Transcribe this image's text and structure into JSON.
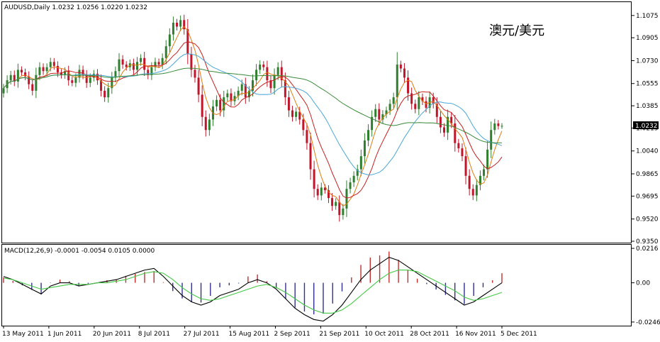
{
  "chart_data": {
    "type": "candlestick",
    "symbol_header": "AUDUSD,Daily  1.0232 1.0256 1.0220 1.0232",
    "annotation": "澳元/美元",
    "current_price_label": "1.0232",
    "price_axis": {
      "ticks": [
        "1.1075",
        "1.0905",
        "1.0730",
        "1.0555",
        "1.0385",
        "1.0215",
        "1.0040",
        "0.9865",
        "0.9695",
        "0.9520",
        "0.9350"
      ],
      "ylim": [
        0.935,
        1.115
      ]
    },
    "x_ticks": [
      "13 May 2011",
      "1 Jun 2011",
      "20 Jun 2011",
      "8 Jul 2011",
      "27 Jul 2011",
      "15 Aug 2011",
      "2 Sep 2011",
      "21 Sep 2011",
      "10 Oct 2011",
      "28 Oct 2011",
      "16 Nov 2011",
      "5 Dec 2011"
    ],
    "macd": {
      "header": "MACD(12,26,9) -0.0001 -0.0054 0.0105 0.0000",
      "ticks": [
        "0.0216",
        "0.00",
        "-0.0246"
      ],
      "ylim": [
        -0.026,
        0.0225
      ]
    },
    "colors": {
      "up": "#2f7f2f",
      "down": "#c0152a",
      "ma_fast": "#e07b10",
      "ma_mid": "#c82020",
      "ma_slow_blue": "#4aa8d8",
      "ma_long": "#3a8a3a",
      "macd_line": "#000000",
      "signal_line": "#44c844",
      "hist_pos": "#c03030",
      "hist_neg": "#303090"
    },
    "closes": [
      1.052,
      1.058,
      1.062,
      1.057,
      1.066,
      1.064,
      1.061,
      1.055,
      1.05,
      1.062,
      1.068,
      1.065,
      1.068,
      1.072,
      1.069,
      1.064,
      1.062,
      1.065,
      1.058,
      1.056,
      1.06,
      1.066,
      1.062,
      1.056,
      1.06,
      1.063,
      1.058,
      1.05,
      1.045,
      1.052,
      1.06,
      1.065,
      1.074,
      1.07,
      1.068,
      1.071,
      1.066,
      1.072,
      1.075,
      1.066,
      1.062,
      1.068,
      1.072,
      1.07,
      1.075,
      1.084,
      1.093,
      1.102,
      1.099,
      1.104,
      1.097,
      1.078,
      1.066,
      1.06,
      1.047,
      1.03,
      1.02,
      1.028,
      1.038,
      1.043,
      1.035,
      1.045,
      1.048,
      1.042,
      1.046,
      1.05,
      1.055,
      1.045,
      1.05,
      1.058,
      1.066,
      1.07,
      1.068,
      1.058,
      1.052,
      1.062,
      1.068,
      1.058,
      1.045,
      1.035,
      1.03,
      1.034,
      1.028,
      1.02,
      1.01,
      0.99,
      0.975,
      0.97,
      0.976,
      0.974,
      0.968,
      0.962,
      0.965,
      0.955,
      0.96,
      0.975,
      0.98,
      0.985,
      0.99,
      1.0,
      1.012,
      1.02,
      1.03,
      1.036,
      1.028,
      1.032,
      1.035,
      1.04,
      1.045,
      1.07,
      1.067,
      1.06,
      1.048,
      1.04,
      1.036,
      1.045,
      1.042,
      1.037,
      1.045,
      1.04,
      1.03,
      1.022,
      1.018,
      1.03,
      1.025,
      1.01,
      1.006,
      1.0,
      0.985,
      0.975,
      0.97,
      0.978,
      0.985,
      0.99,
      1.005,
      1.02,
      1.025,
      1.023,
      1.0232
    ],
    "macd_line": [
      0.004,
      0.002,
      -0.001,
      -0.004,
      -0.007,
      -0.002,
      0.0,
      0.0,
      -0.002,
      -0.001,
      0.0,
      0.001,
      0.002,
      0.004,
      0.006,
      0.008,
      0.009,
      0.004,
      -0.002,
      -0.008,
      -0.012,
      -0.014,
      -0.012,
      -0.008,
      -0.006,
      -0.004,
      0.0,
      0.002,
      0.0,
      -0.004,
      -0.01,
      -0.016,
      -0.02,
      -0.023,
      -0.024,
      -0.02,
      -0.014,
      -0.006,
      0.002,
      0.008,
      0.012,
      0.016,
      0.014,
      0.01,
      0.006,
      0.002,
      -0.002,
      -0.006,
      -0.01,
      -0.014,
      -0.012,
      -0.008,
      -0.004,
      0.0
    ],
    "signal_line": [
      0.003,
      0.002,
      0.0,
      -0.002,
      -0.004,
      -0.003,
      -0.002,
      -0.001,
      -0.001,
      -0.001,
      0.0,
      0.0,
      0.001,
      0.002,
      0.004,
      0.006,
      0.007,
      0.006,
      0.002,
      -0.003,
      -0.007,
      -0.01,
      -0.011,
      -0.01,
      -0.008,
      -0.006,
      -0.004,
      -0.002,
      -0.001,
      -0.003,
      -0.006,
      -0.01,
      -0.014,
      -0.017,
      -0.019,
      -0.019,
      -0.017,
      -0.013,
      -0.008,
      -0.003,
      0.002,
      0.006,
      0.008,
      0.008,
      0.007,
      0.004,
      0.001,
      -0.002,
      -0.005,
      -0.009,
      -0.011,
      -0.01,
      -0.008,
      -0.006
    ]
  }
}
